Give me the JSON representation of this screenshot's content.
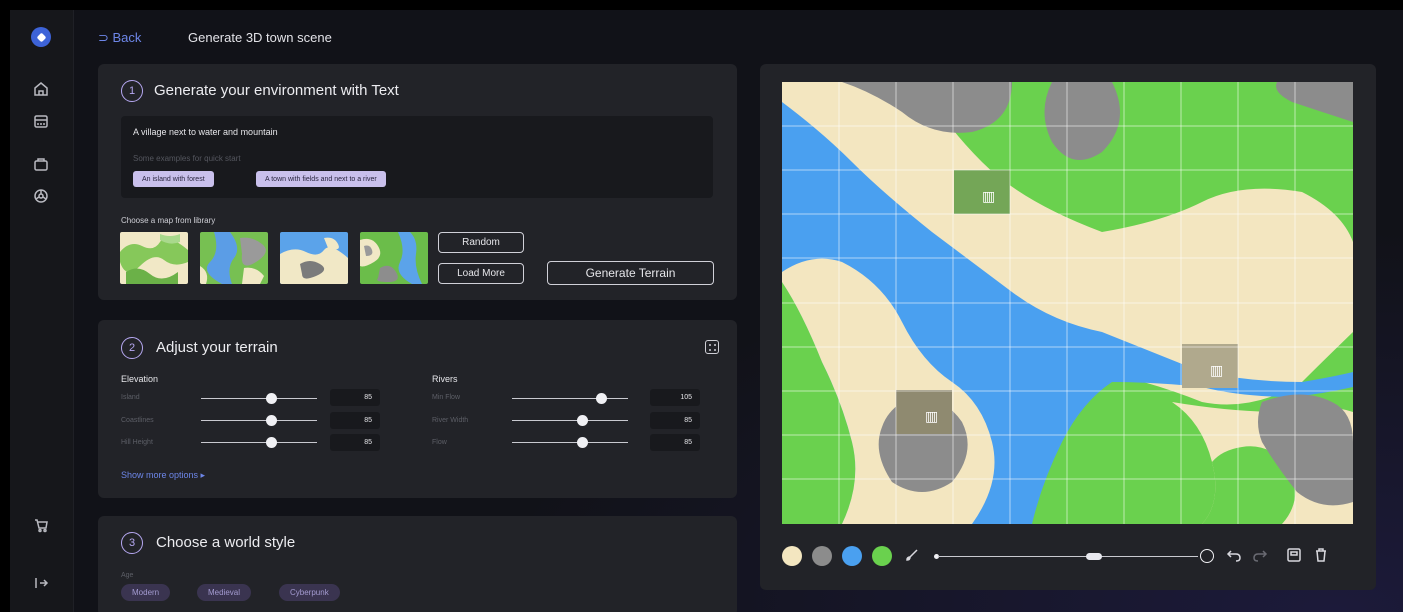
{
  "header": {
    "back_label": "Back",
    "page_title": "Generate 3D town scene"
  },
  "sidebar": {
    "items": [
      "home-icon",
      "store-icon",
      "bag-icon",
      "settings-icon"
    ],
    "bottom": [
      "cart-icon",
      "logout-icon"
    ]
  },
  "step1": {
    "number": "1",
    "title": "Generate your environment with Text",
    "prompt_value": "A village next to water and mountain",
    "examples_hint": "Some examples for quick start",
    "examples": [
      "An island with forest",
      "A town with fields and next to a river"
    ],
    "library_label": "Choose a map from library",
    "random_label": "Random",
    "load_more_label": "Load More",
    "generate_label": "Generate Terrain"
  },
  "step2": {
    "number": "2",
    "title": "Adjust your terrain",
    "elevation": {
      "label": "Elevation",
      "rows": [
        {
          "name": "Island",
          "value": "85",
          "level": 0.6
        },
        {
          "name": "Coastlines",
          "value": "85",
          "level": 0.6
        },
        {
          "name": "Hill Height",
          "value": "85",
          "level": 0.6
        }
      ]
    },
    "rivers": {
      "label": "Rivers",
      "rows": [
        {
          "name": "Min Flow",
          "value": "105",
          "level": 0.77
        },
        {
          "name": "River Width",
          "value": "85",
          "level": 0.6
        },
        {
          "name": "Flow",
          "value": "85",
          "level": 0.6
        }
      ]
    },
    "show_more": "Show more options  ▸"
  },
  "step3": {
    "number": "3",
    "title": "Choose a world style",
    "age_label": "Age",
    "styles": [
      "Modern",
      "Medieval",
      "Cyberpunk"
    ]
  },
  "map_tools": {
    "colors": [
      "#f3e6c0",
      "#8c8c8c",
      "#4aa0f0",
      "#6ad14e"
    ],
    "brush_size": 0.6
  }
}
